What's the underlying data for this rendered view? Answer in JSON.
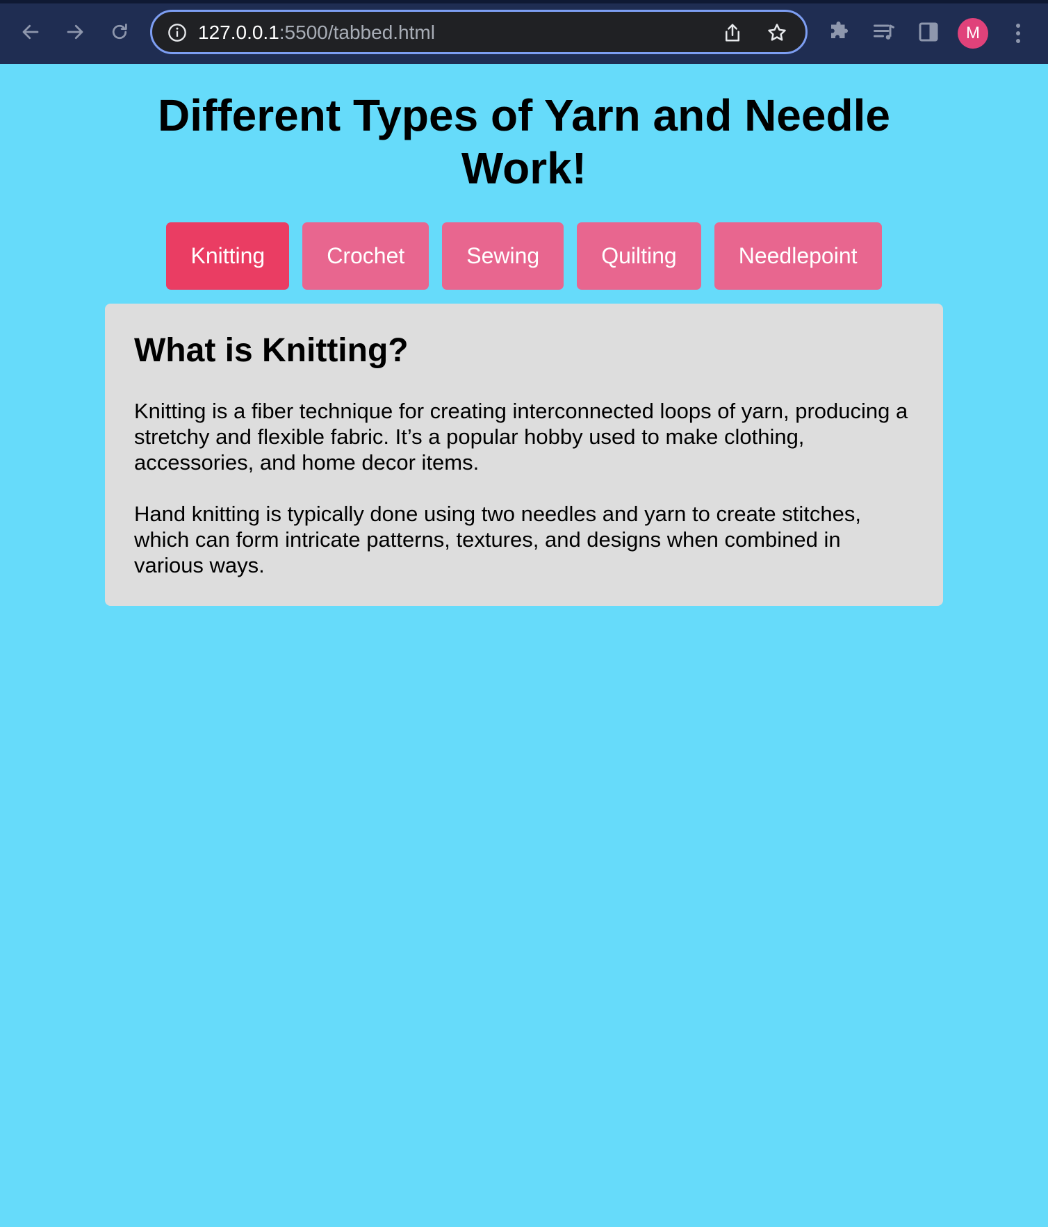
{
  "browser": {
    "url_host": "127.0.0.1",
    "url_path": ":5500/tabbed.html",
    "avatar_letter": "M",
    "icons": [
      "back-arrow-icon",
      "forward-arrow-icon",
      "reload-icon",
      "info-icon",
      "share-icon",
      "bookmark-star-icon",
      "extensions-puzzle-icon",
      "media-queue-icon",
      "side-panel-icon",
      "menu-kebab-icon"
    ],
    "colors": {
      "chrome_bg": "#1f2d52",
      "address_border": "#7d9ef2",
      "avatar": "#e0427a"
    }
  },
  "page": {
    "title": "Different Types of Yarn and Needle Work!",
    "colors": {
      "background": "#66dbfa",
      "tab": "#e8668f",
      "tab_active": "#ea3d63",
      "panel": "#dddddd"
    },
    "tabs": [
      {
        "label": "Knitting",
        "active": true
      },
      {
        "label": "Crochet",
        "active": false
      },
      {
        "label": "Sewing",
        "active": false
      },
      {
        "label": "Quilting",
        "active": false
      },
      {
        "label": "Needlepoint",
        "active": false
      }
    ],
    "panel": {
      "heading": "What is Knitting?",
      "paragraphs": [
        "Knitting is a fiber technique for creating interconnected loops of yarn, producing a stretchy and flexible fabric. It’s a popular hobby used to make clothing, accessories, and home decor items.",
        "Hand knitting is typically done using two needles and yarn to create stitches, which can form intricate patterns, textures, and designs when combined in various ways."
      ]
    }
  }
}
